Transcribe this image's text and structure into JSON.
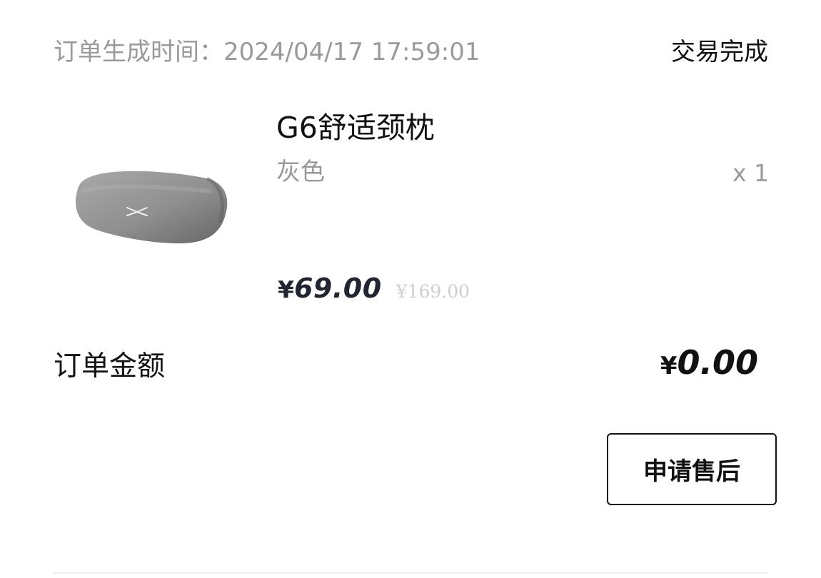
{
  "order": {
    "time_label": "订单生成时间：",
    "time_value": "2024/04/17 17:59:01",
    "status": "交易完成"
  },
  "product": {
    "name": "G6舒适颈枕",
    "variant": "灰色",
    "quantity": "x 1",
    "currency_symbol": "¥",
    "price": "69.00",
    "original_price": "¥169.00",
    "image_icon": "neck-pillow-image"
  },
  "summary": {
    "total_label": "订单金额",
    "currency_symbol": "¥",
    "total_value": "0.00"
  },
  "actions": {
    "after_sale_label": "申请售后"
  },
  "colors": {
    "primary_text": "#111111",
    "secondary_text": "#9a9a9a",
    "price_text": "#222631",
    "original_price_text": "#cfcfcf"
  }
}
